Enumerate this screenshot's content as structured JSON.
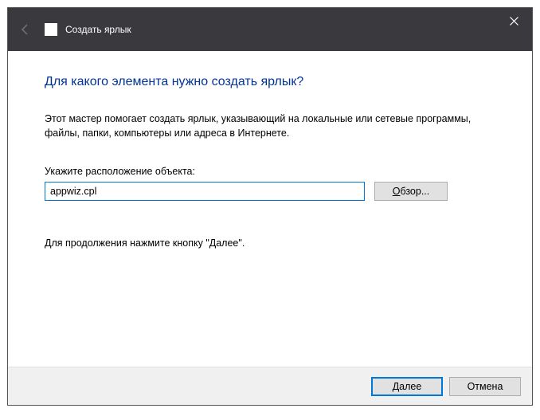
{
  "titlebar": {
    "title": "Создать ярлык"
  },
  "content": {
    "heading": "Для какого элемента нужно создать ярлык?",
    "description": "Этот мастер помогает создать ярлык, указывающий на локальные или сетевые программы, файлы, папки, компьютеры или адреса в Интернете.",
    "field_label": "Укажите расположение объекта:",
    "field_value": "appwiz.cpl",
    "browse_prefix": "О",
    "browse_suffix": "бзор...",
    "continue_text": "Для продолжения нажмите кнопку \"Далее\"."
  },
  "footer": {
    "next_prefix": "Д",
    "next_suffix": "алее",
    "cancel": "Отмена"
  }
}
